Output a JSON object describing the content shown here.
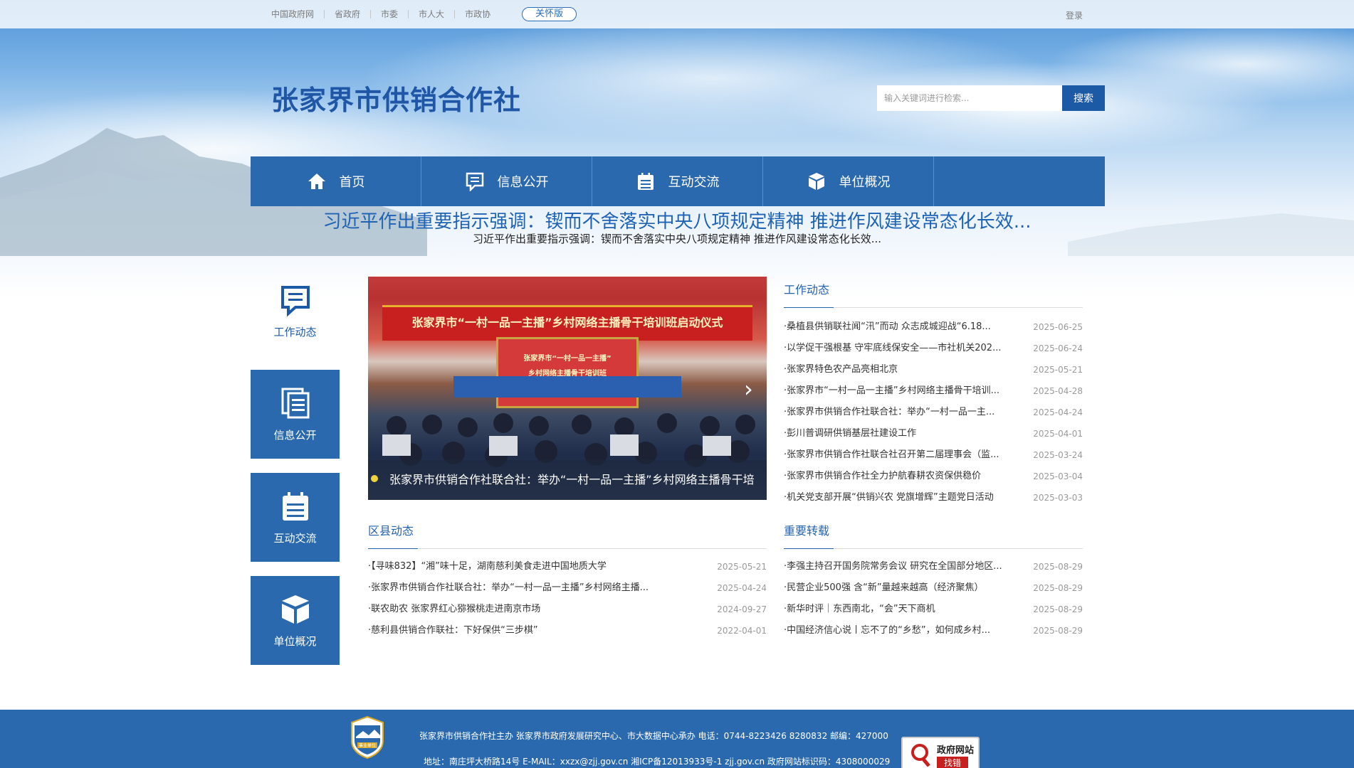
{
  "topbar": {
    "links": [
      "中国政府网",
      "省政府",
      "市委",
      "市人大",
      "市政协"
    ],
    "care_button": "关怀版",
    "login": "登录"
  },
  "site": {
    "title": "张家界市供销合作社"
  },
  "search": {
    "placeholder": "输入关键词进行检索...",
    "button": "搜索"
  },
  "nav": [
    {
      "label": "首页",
      "icon": "home-icon"
    },
    {
      "label": "信息公开",
      "icon": "message-icon"
    },
    {
      "label": "互动交流",
      "icon": "clipboard-icon"
    },
    {
      "label": "单位概况",
      "icon": "box-icon"
    }
  ],
  "headline": {
    "title": "习近平作出重要指示强调：锲而不舍落实中央八项规定精神 推进作风建设常态化长效...",
    "subtitle": "习近平作出重要指示强调：锲而不舍落实中央八项规定精神 推进作风建设常态化长效..."
  },
  "side_menu": [
    {
      "label": "工作动态",
      "icon": "message-icon"
    },
    {
      "label": "信息公开",
      "icon": "document-icon"
    },
    {
      "label": "互动交流",
      "icon": "clipboard-icon"
    },
    {
      "label": "单位概况",
      "icon": "box-icon"
    }
  ],
  "carousel": {
    "caption": "张家界市供销合作社联合社：举办“一村一品一主播”乡村网络主播骨干培",
    "banner_text": "张家界市“一村一品一主播”乡村网络主播骨干培训班启动仪式",
    "screen_text_1": "张家界市“一村一品一主播”",
    "screen_text_2": "乡村网络主播骨干培训班"
  },
  "work_news": {
    "title": "工作动态",
    "items": [
      {
        "title": "·桑植县供销联社闻“汛”而动 众志成城迎战“6.18...",
        "date": "2025-06-25"
      },
      {
        "title": "·以学促干强根基 守牢底线保安全——市社机关202...",
        "date": "2025-06-24"
      },
      {
        "title": "·张家界特色农产品亮相北京",
        "date": "2025-05-21"
      },
      {
        "title": "·张家界市“一村一品一主播”乡村网络主播骨干培训...",
        "date": "2025-04-28"
      },
      {
        "title": "·张家界市供销合作社联合社：举办“一村一品一主...",
        "date": "2025-04-24"
      },
      {
        "title": "·彭川普调研供销基层社建设工作",
        "date": "2025-04-01"
      },
      {
        "title": "·张家界市供销合作社联合社召开第二届理事会（监...",
        "date": "2025-03-24"
      },
      {
        "title": "·张家界市供销合作社全力护航春耕农资保供稳价",
        "date": "2025-03-04"
      },
      {
        "title": "·机关党支部开展“供销兴农 党旗增辉”主题党日活动",
        "date": "2025-03-03"
      }
    ]
  },
  "county_news": {
    "title": "区县动态",
    "items": [
      {
        "title": "·【寻味832】“湘”味十足，湖南慈利美食走进中国地质大学",
        "date": "2025-05-21"
      },
      {
        "title": "·张家界市供销合作社联合社：举办“一村一品一主播”乡村网络主播...",
        "date": "2025-04-24"
      },
      {
        "title": "·联农助农 张家界红心猕猴桃走进南京市场",
        "date": "2024-09-27"
      },
      {
        "title": "·慈利县供销合作联社：下好保供“三步棋”",
        "date": "2022-04-01"
      }
    ]
  },
  "reprint_news": {
    "title": "重要转载",
    "items": [
      {
        "title": "·李强主持召开国务院常务会议 研究在全国部分地区...",
        "date": "2025-08-29"
      },
      {
        "title": "·民营企业500强 含“新”量越来越高（经济聚焦）",
        "date": "2025-08-29"
      },
      {
        "title": "·新华时评｜东西南北，“会”天下商机",
        "date": "2025-08-29"
      },
      {
        "title": "·中国经济信心说丨忘不了的“乡愁”，如何成乡村...",
        "date": "2025-08-29"
      }
    ]
  },
  "footer": {
    "line1": "张家界市供销合作社主办 张家界市政府发展研究中心、市大数据中心承办 电话：0744-8223426 8280832 邮编：427000",
    "line2": "地址：南庄坪大桥路14号 E-MAIL：xxzx@zjj.gov.cn 湘ICP备12013933号-1 zjj.gov.cn 政府网站标识码：4308000029",
    "emblem_text": "事业单位",
    "error_badge_1": "政府网站",
    "error_badge_2": "找错"
  },
  "colors": {
    "primary": "#2a69ad",
    "title_blue": "#1f56a6",
    "link_blue": "#2563ad"
  }
}
